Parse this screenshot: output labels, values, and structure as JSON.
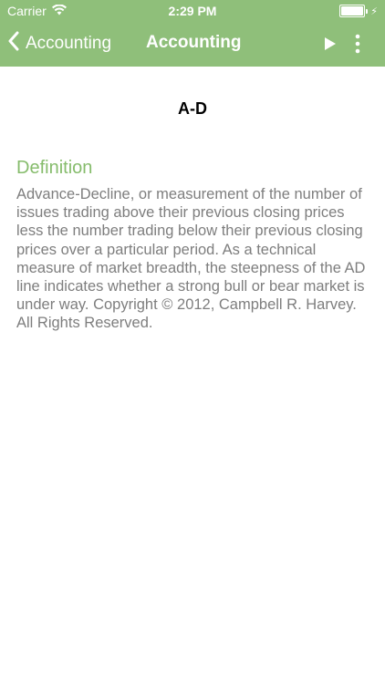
{
  "status_bar": {
    "carrier": "Carrier",
    "time": "2:29 PM",
    "battery_level_percent": 100
  },
  "navbar": {
    "back_label": "Accounting",
    "title": "Accounting"
  },
  "term": {
    "title": "A-D",
    "definition_heading": "Definition",
    "definition_text": "Advance-Decline, or measurement of the number of issues trading above their previous closing prices less the number trading below their previous closing prices over a particular period. As a technical measure of market breadth, the steepness of the AD line indicates whether a strong bull or bear market is under way. Copyright © 2012, Campbell R. Harvey. All Rights Reserved."
  },
  "colors": {
    "topbar_bg": "#8fbf7a",
    "heading_green": "#86bc6c",
    "body_text": "#7e7e7e"
  },
  "icons": [
    "wifi-icon",
    "battery-icon",
    "charging-bolt-icon",
    "chevron-left-icon",
    "play-icon",
    "more-vertical-icon"
  ]
}
